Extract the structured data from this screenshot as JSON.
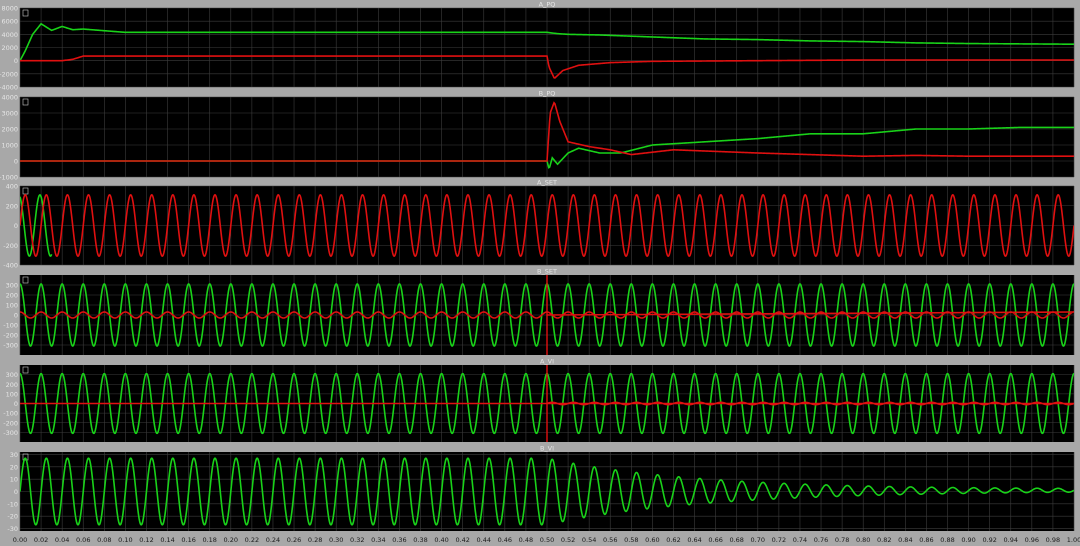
{
  "colors": {
    "background": "#a8a8a8",
    "panel_bg": "#000000",
    "grid": "#3c3c3c",
    "green": "#19d219",
    "red": "#e01010",
    "tick_text": "#e6e6e6"
  },
  "x_axis": {
    "range": [
      0.0,
      1.0
    ],
    "ticks": [
      "0.00",
      "0.02",
      "0.04",
      "0.06",
      "0.08",
      "0.10",
      "0.12",
      "0.14",
      "0.16",
      "0.18",
      "0.20",
      "0.22",
      "0.24",
      "0.26",
      "0.28",
      "0.30",
      "0.32",
      "0.34",
      "0.36",
      "0.38",
      "0.40",
      "0.42",
      "0.44",
      "0.46",
      "0.48",
      "0.50",
      "0.52",
      "0.54",
      "0.56",
      "0.58",
      "0.60",
      "0.62",
      "0.64",
      "0.66",
      "0.68",
      "0.70",
      "0.72",
      "0.74",
      "0.76",
      "0.78",
      "0.80",
      "0.82",
      "0.84",
      "0.86",
      "0.88",
      "0.90",
      "0.92",
      "0.94",
      "0.96",
      "0.98",
      "1.00"
    ]
  },
  "chart_data": [
    {
      "type": "line",
      "title": "A_PQ",
      "ylim": [
        -4000,
        8000
      ],
      "yticks": [
        "8000",
        "6000",
        "4000",
        "2000",
        "0",
        "-2000",
        "-4000"
      ],
      "grid": true,
      "series": [
        {
          "color": "green",
          "x": [
            0.0,
            0.005,
            0.012,
            0.02,
            0.03,
            0.04,
            0.05,
            0.06,
            0.1,
            0.2,
            0.49,
            0.5,
            0.51,
            0.52,
            0.55,
            0.6,
            0.65,
            0.7,
            0.75,
            0.8,
            0.85,
            0.9,
            1.0
          ],
          "y": [
            0,
            1500,
            4000,
            5600,
            4600,
            5200,
            4700,
            4800,
            4300,
            4300,
            4300,
            4300,
            4100,
            4000,
            3900,
            3600,
            3300,
            3200,
            3000,
            2900,
            2700,
            2600,
            2500
          ]
        },
        {
          "color": "red",
          "x": [
            0.0,
            0.04,
            0.05,
            0.06,
            0.1,
            0.4,
            0.49,
            0.5,
            0.502,
            0.507,
            0.515,
            0.53,
            0.56,
            0.6,
            0.7,
            0.8,
            1.0
          ],
          "y": [
            0,
            0,
            200,
            700,
            700,
            700,
            700,
            700,
            -1000,
            -2700,
            -1500,
            -700,
            -300,
            -100,
            0,
            100,
            100
          ]
        }
      ]
    },
    {
      "type": "line",
      "title": "B_PQ",
      "ylim": [
        -1000,
        4000
      ],
      "yticks": [
        "4000",
        "3000",
        "2000",
        "1000",
        "0",
        "-1000"
      ],
      "grid": true,
      "series": [
        {
          "color": "green",
          "x": [
            0.0,
            0.49,
            0.5,
            0.502,
            0.505,
            0.51,
            0.52,
            0.53,
            0.55,
            0.57,
            0.6,
            0.65,
            0.7,
            0.75,
            0.8,
            0.85,
            0.9,
            0.95,
            1.0
          ],
          "y": [
            0,
            0,
            0,
            -500,
            200,
            -200,
            500,
            800,
            500,
            500,
            1000,
            1200,
            1400,
            1700,
            1700,
            2000,
            2000,
            2100,
            2100
          ]
        },
        {
          "color": "red",
          "x": [
            0.0,
            0.49,
            0.5,
            0.503,
            0.507,
            0.512,
            0.52,
            0.54,
            0.56,
            0.58,
            0.62,
            0.66,
            0.7,
            0.75,
            0.8,
            0.85,
            0.9,
            1.0
          ],
          "y": [
            0,
            0,
            0,
            3000,
            3700,
            2500,
            1200,
            900,
            700,
            400,
            700,
            600,
            500,
            400,
            300,
            350,
            300,
            300
          ]
        }
      ]
    },
    {
      "type": "line",
      "title": "A_SET",
      "ylim": [
        -400,
        400
      ],
      "yticks": [
        "400",
        "200",
        "0",
        "-200",
        "-400"
      ],
      "grid": true,
      "series": [
        {
          "color": "green",
          "kind": "sine",
          "amplitude": 310,
          "frequency_hz": 50,
          "phase_deg": 110,
          "until": 0.03
        },
        {
          "color": "red",
          "kind": "sine",
          "amplitude": 310,
          "frequency_hz": 50,
          "phase_deg": 0,
          "until": 1.0
        }
      ]
    },
    {
      "type": "line",
      "title": "B_SET",
      "ylim": [
        -400,
        400
      ],
      "yticks": [
        "300",
        "200",
        "100",
        "0",
        "-100",
        "-200",
        "-300"
      ],
      "grid": true,
      "series": [
        {
          "color": "green",
          "kind": "sine",
          "amplitude": 310,
          "frequency_hz": 50,
          "phase_deg": 90,
          "until": 1.0
        },
        {
          "color": "red",
          "kind": "sine",
          "amplitude": 30,
          "frequency_hz": 50,
          "phase_deg": 90,
          "until": 1.0,
          "spike_at": 0.5
        }
      ]
    },
    {
      "type": "line",
      "title": "A_VI",
      "ylim": [
        -400,
        400
      ],
      "yticks": [
        "300",
        "200",
        "100",
        "0",
        "-100",
        "-200",
        "-300"
      ],
      "grid": true,
      "series": [
        {
          "color": "green",
          "kind": "sine",
          "amplitude": 310,
          "frequency_hz": 50,
          "phase_deg": 90,
          "until": 1.0
        },
        {
          "color": "red",
          "kind": "sine",
          "amplitude": 12,
          "frequency_hz": 50,
          "phase_deg": 0,
          "until": 1.0,
          "start_after": 0.5,
          "spike_at": 0.5
        }
      ]
    },
    {
      "type": "line",
      "title": "B_VI",
      "ylim": [
        -32,
        32
      ],
      "yticks": [
        "30",
        "20",
        "10",
        "0",
        "-10",
        "-20",
        "-30"
      ],
      "grid": true,
      "series": [
        {
          "color": "green",
          "kind": "decaying_sine",
          "amplitude": 27,
          "frequency_hz": 50,
          "phase_deg": 0,
          "decay_start": 0.5,
          "decay_end_amplitude": 1.5,
          "final_offset": 1,
          "until": 1.0
        }
      ]
    }
  ]
}
